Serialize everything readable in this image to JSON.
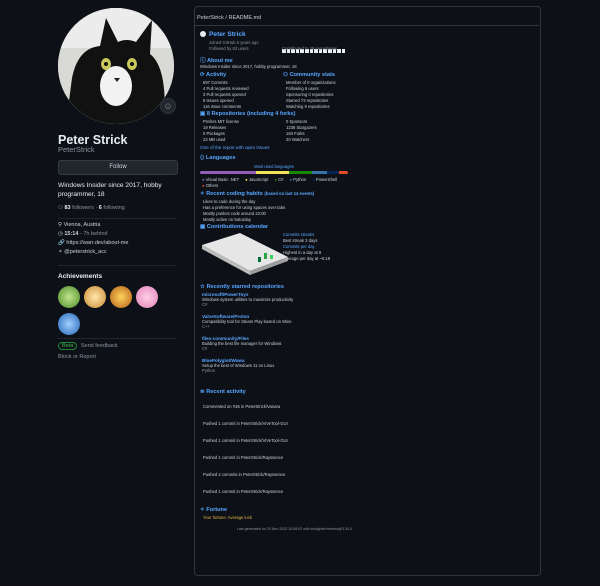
{
  "profile": {
    "name": "Peter Strick",
    "login": "PeterStrick",
    "follow_label": "Follow",
    "bio": "Windows Insider since 2017, hobby programmer, 18",
    "followers_count": "83",
    "followers_label": "followers",
    "following_count": "6",
    "following_label": "following",
    "location": "Vienna, Austria",
    "local_time": "15:14",
    "local_time_suffix": "- 7h behind",
    "website": "https://warr.dev/about-me",
    "twitter": "@peterstrick_acc",
    "achievements_title": "Achievements",
    "beta_pill": "Beta",
    "beta_text": "Send feedback",
    "block_text": "Block or Report"
  },
  "panel": {
    "breadcrumb": "PeterStrick / README.md",
    "header": {
      "title": "Peter Strick",
      "joined": "Joined GitHub 6 years ago",
      "followed": "Followed by 83 users",
      "contributed": "Contributed to 29 repositories"
    },
    "about_title": "About me",
    "about_text": "Windows Insider since 2017, hobby programmer, 18",
    "activity": {
      "title": "Activity",
      "items": [
        "697 Commits",
        "4 Pull requests reviewed",
        "3 Pull requests opened",
        "6 Issues opened",
        "116 issue comments"
      ]
    },
    "community": {
      "title": "Community stats",
      "items": [
        "Member of 0 organizations",
        "Following 6 users",
        "Sponsoring 0 repositories",
        "Starred 73 repositories",
        "Watching 9 repositories"
      ]
    },
    "repos": {
      "title": "8 Repositories (including 4 forks)",
      "left": [
        "Prefers MIT license",
        "19 Releases",
        "0 Packages",
        "22 MB used"
      ],
      "right": [
        "0 Sponsors",
        "1236 Stargazers",
        "184 Forks",
        "20 Watchers"
      ]
    },
    "ossbar_link": "One of the repos with open issues",
    "languages": {
      "title": "Languages",
      "subtitle": "Most used languages",
      "items": [
        "Visual Basic .NET",
        "JavaScript",
        "C#",
        "Python",
        "PowerShell",
        "Others"
      ],
      "colors": [
        "#945db7",
        "#f1e05a",
        "#178600",
        "#3572A5",
        "#012456",
        "#e34c26"
      ]
    },
    "habits": {
      "title": "Recent coding habits",
      "note": "(based on last 14 events)",
      "lines": [
        "Likes to code during the day",
        "Has a preference for using spaces over tabs",
        "Mostly pushes code around 22:00",
        "Mostly active on Saturday"
      ]
    },
    "calendar": {
      "title": "Contributions calendar",
      "stats": [
        "Commits streaks",
        "Best streak 3 days",
        "Commits per day",
        "Highest in a day at 9",
        "Average per day at ~0.18"
      ]
    },
    "starred": {
      "title": "Recently starred repositories",
      "items": [
        {
          "name": "microsoft/PowerToys",
          "desc": "Windows system utilities to maximize productivity",
          "lang": "C#"
        },
        {
          "name": "ValveSoftware/Proton",
          "desc": "Compatibility tool for Steam Play based on Wine",
          "lang": "C++"
        },
        {
          "name": "files-community/Files",
          "desc": "Building the best file manager for Windows",
          "lang": "C#"
        },
        {
          "name": "BluePolyglot/Wuwa",
          "desc": "Setup the best of Windows 11 on Linux",
          "lang": "Python"
        }
      ]
    },
    "recent": {
      "title": "Recent activity",
      "items": [
        "Commented on #35 in PeterStrick/Vanara",
        "Pushed 1 commit in PeterStrick/ViVeTool-GUI",
        "Pushed 1 commit in PeterStrick/ViVeTool-GUI",
        "Pushed 1 commit in PeterStrick/Rayssence",
        "Pushed 2 commits in PeterStrick/Rayssence",
        "Pushed 1 commit in PeterStrick/Rayssence"
      ]
    },
    "footer": {
      "title": "Fortune",
      "quote": "Your fortune: Average luck"
    },
    "timestamp": "Last generated on 20 Nov 2023 15:58:02 with lowlighter/metrics@3.34.0"
  },
  "colors": {
    "accent": "#58a6ff",
    "bg": "#0d1117",
    "border": "#30363d"
  }
}
